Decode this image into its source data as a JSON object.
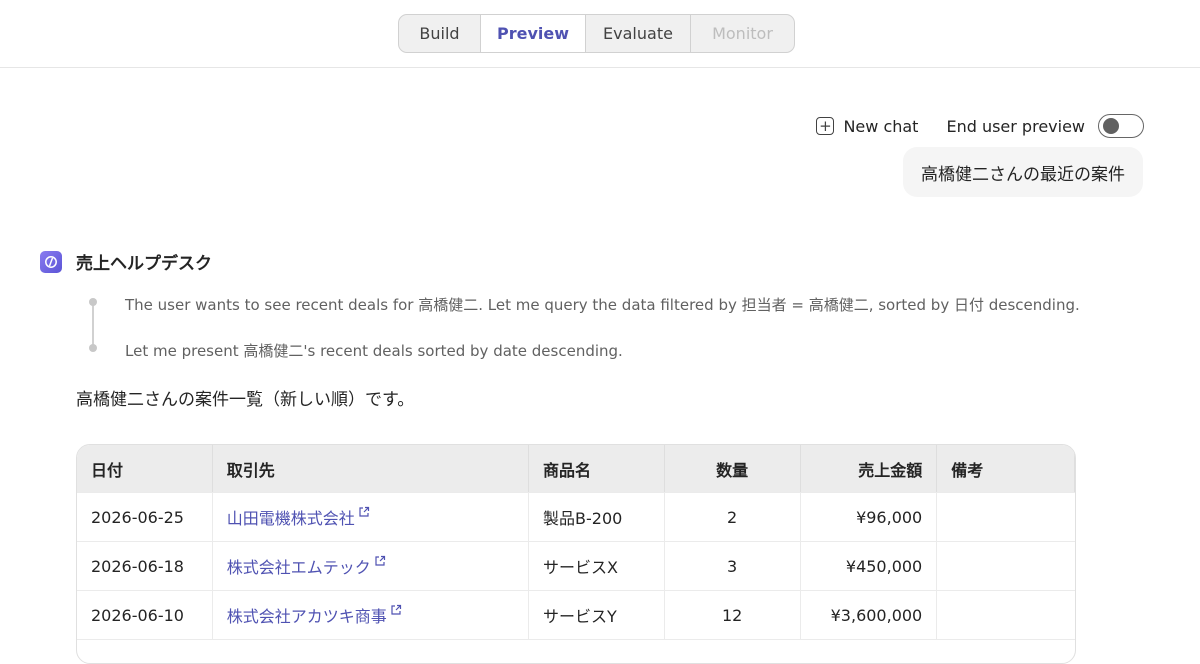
{
  "tabs": [
    "Build",
    "Preview",
    "Evaluate",
    "Monitor"
  ],
  "toolbar": {
    "new_chat_label": "New chat",
    "end_user_preview_label": "End user preview",
    "end_user_preview_enabled": false
  },
  "conversation": {
    "user_message": "高橋健二さんの最近の案件",
    "bot_name": "売上ヘルプデスク",
    "thoughts": [
      "The user wants to see recent deals for 高橋健二. Let me query the data filtered by 担当者 = 高橋健二, sorted by 日付 descending.",
      "Let me present 高橋健二's recent deals sorted by date descending."
    ],
    "answer_text": "高橋健二さんの案件一覧（新しい順）です。"
  },
  "table": {
    "headers": [
      "日付",
      "取引先",
      "商品名",
      "数量",
      "売上金額",
      "備考"
    ],
    "rows": [
      [
        "2026-06-25",
        "山田電機株式会社",
        "製品B-200",
        "2",
        "¥96,000",
        ""
      ],
      [
        "2026-06-18",
        "株式会社エムテック",
        "サービスX",
        "3",
        "¥450,000",
        ""
      ],
      [
        "2026-06-10",
        "株式会社アカツキ商事",
        "サービスY",
        "12",
        "¥3,600,000",
        ""
      ]
    ]
  },
  "colors": {
    "accent": "#4f52b2",
    "link": "#4f52b2",
    "muted_text": "#616161"
  },
  "icons": {
    "new_chat": "plus-square-icon",
    "bot_avatar": "copilot-agent-icon",
    "external_link": "external-link-icon"
  }
}
